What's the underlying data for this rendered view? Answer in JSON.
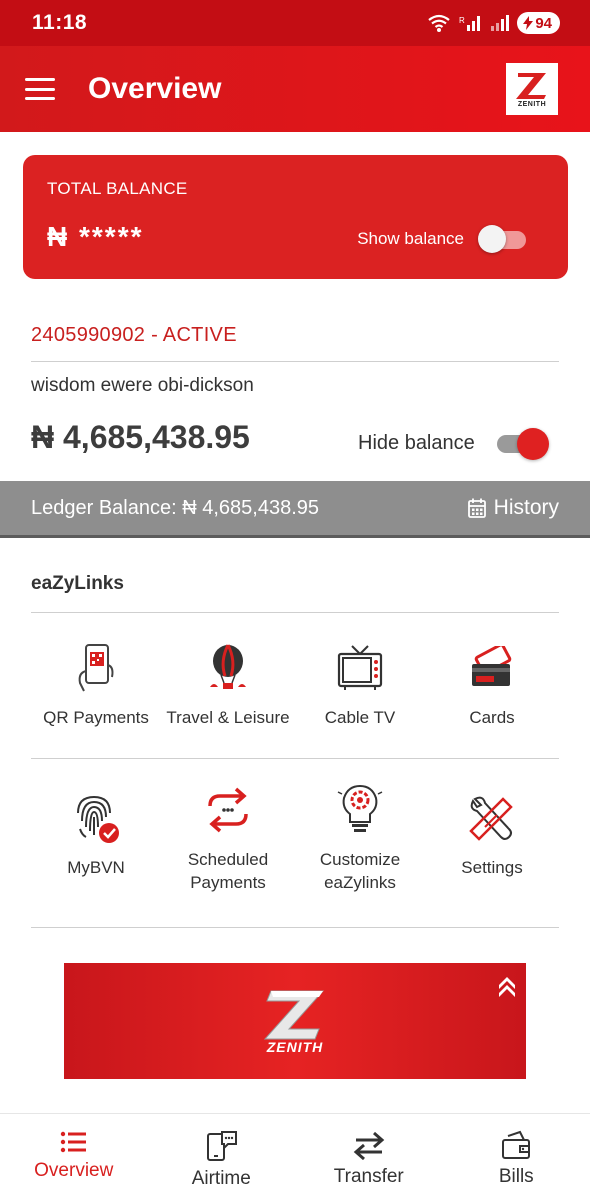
{
  "status_bar": {
    "time": "11:18",
    "battery": "94"
  },
  "header": {
    "title": "Overview",
    "logo_text": "ZENITH"
  },
  "total_balance": {
    "label": "TOTAL BALANCE",
    "masked_value": "₦ *****",
    "toggle_label": "Show balance",
    "toggle_on": false
  },
  "account": {
    "line": "2405990902  - ACTIVE",
    "name": "wisdom ewere obi-dickson",
    "balance": "₦ 4,685,438.95",
    "toggle_label": "Hide balance",
    "toggle_on": true
  },
  "ledger": {
    "text": "Ledger Balance: ₦ 4,685,438.95",
    "history_label": "History"
  },
  "eazylinks": {
    "title": "eaZyLinks",
    "row1": [
      {
        "label": "QR Payments",
        "icon": "qr-phone-icon"
      },
      {
        "label": "Travel & Leisure",
        "icon": "hot-air-balloon-icon"
      },
      {
        "label": "Cable TV",
        "icon": "tv-icon"
      },
      {
        "label": "Cards",
        "icon": "cards-icon"
      }
    ],
    "row2": [
      {
        "label": "MyBVN",
        "icon": "fingerprint-icon"
      },
      {
        "label": "Scheduled\nPayments",
        "icon": "repeat-arrows-icon"
      },
      {
        "label": "Customize\neaZylinks",
        "icon": "lightbulb-gear-icon"
      },
      {
        "label": "Settings",
        "icon": "tools-icon"
      }
    ]
  },
  "banner": {
    "logo_text": "ZENITH"
  },
  "bottom_nav": [
    {
      "label": "Overview",
      "icon": "list-icon",
      "active": true
    },
    {
      "label": "Airtime",
      "icon": "phone-chat-icon",
      "active": false
    },
    {
      "label": "Transfer",
      "icon": "swap-arrows-icon",
      "active": false
    },
    {
      "label": "Bills",
      "icon": "wallet-icon",
      "active": false
    }
  ],
  "colors": {
    "brand_red": "#d8201f",
    "grey_bar": "#8e8e8e"
  }
}
